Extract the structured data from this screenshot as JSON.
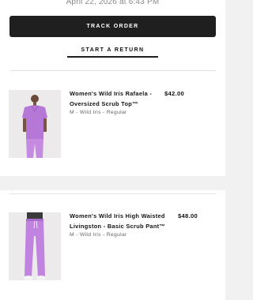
{
  "order": {
    "date_text": "April 22, 2026 at 6:43 PM",
    "track_button": "TRACK ORDER",
    "return_link": "START A RETURN"
  },
  "items": [
    {
      "name": "Women's Wild Iris Rafaela - Oversized Scrub Top™",
      "variant": "M - Wild Iris - Regular",
      "price": "$42.00",
      "image": "scrub-top-photo"
    },
    {
      "name": "Women's Wild Iris High Waisted Livingston - Basic Scrub Pant™",
      "variant": "M - Wild Iris - Regular",
      "price": "$48.00",
      "image": "scrub-pant-photo"
    }
  ],
  "colors": {
    "button_bg": "#1f1f1f",
    "page_bg": "#f1f1f1",
    "wild_iris": "#b678d6"
  }
}
